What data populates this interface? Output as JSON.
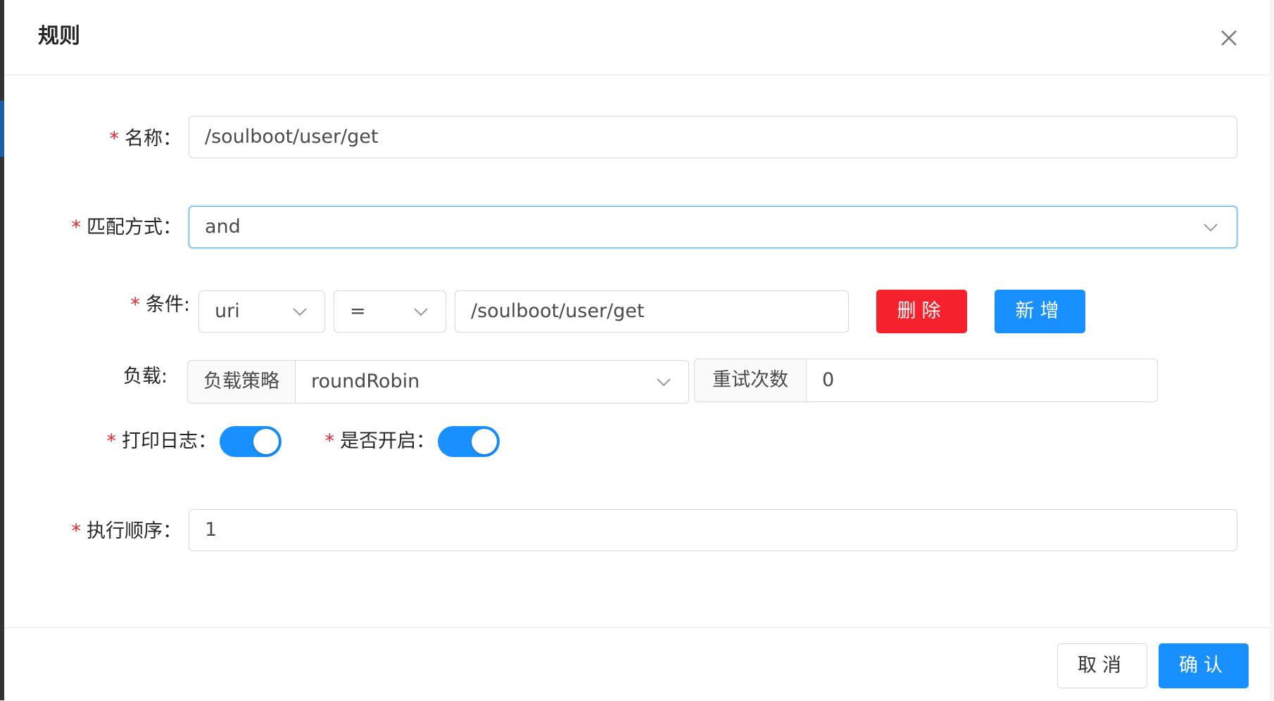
{
  "modal": {
    "title": "规则"
  },
  "form": {
    "name": {
      "label": "名称：",
      "value": "/soulboot/user/get"
    },
    "match_mode": {
      "label": "匹配方式：",
      "value": "and"
    },
    "condition": {
      "label": "条件:",
      "param_type": "uri",
      "operator": "=",
      "value": "/soulboot/user/get",
      "delete_label": "删除",
      "add_label": "新增"
    },
    "load": {
      "label": "负载:",
      "strategy_addon": "负载策略",
      "strategy_value": "roundRobin",
      "retry_addon": "重试次数",
      "retry_value": "0"
    },
    "log": {
      "label": "打印日志：",
      "on": true
    },
    "enabled": {
      "label": "是否开启：",
      "on": true
    },
    "sort": {
      "label": "执行顺序：",
      "value": "1"
    }
  },
  "footer": {
    "cancel_label": "取消",
    "confirm_label": "确认"
  },
  "colors": {
    "primary": "#1890ff",
    "danger": "#f5222d",
    "required": "#f5222d"
  }
}
